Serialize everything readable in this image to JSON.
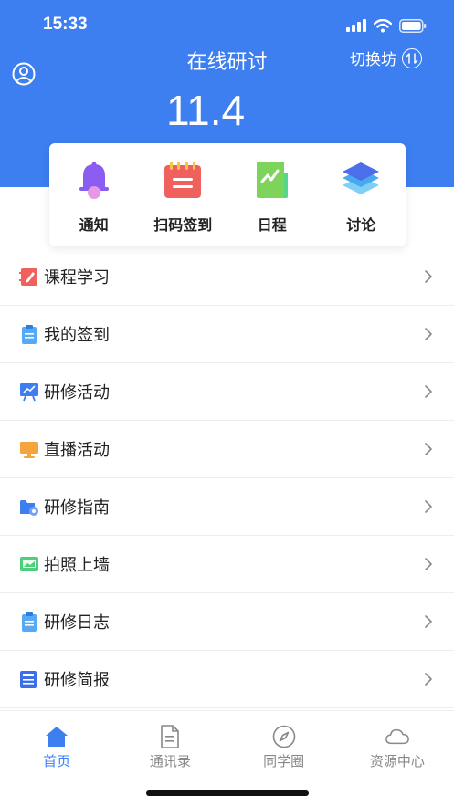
{
  "status": {
    "time": "15:33"
  },
  "header": {
    "title": "在线研讨",
    "switch_label": "切换坊",
    "date": "11.4",
    "colors": {
      "primary": "#3d7ff0"
    }
  },
  "quick_actions": [
    {
      "label": "通知",
      "icon": "bell-icon"
    },
    {
      "label": "扫码签到",
      "icon": "calendar-icon"
    },
    {
      "label": "日程",
      "icon": "chart-card-icon"
    },
    {
      "label": "讨论",
      "icon": "layers-icon"
    }
  ],
  "menu": [
    {
      "label": "课程学习",
      "icon": "notebook-pencil-icon"
    },
    {
      "label": "我的签到",
      "icon": "clipboard-icon"
    },
    {
      "label": "研修活动",
      "icon": "presentation-board-icon"
    },
    {
      "label": "直播活动",
      "icon": "monitor-icon"
    },
    {
      "label": "研修指南",
      "icon": "folder-gear-icon"
    },
    {
      "label": "拍照上墙",
      "icon": "photo-icon"
    },
    {
      "label": "研修日志",
      "icon": "clipboard-icon"
    },
    {
      "label": "研修简报",
      "icon": "newspaper-icon"
    }
  ],
  "tabs": [
    {
      "label": "首页",
      "icon": "home-icon",
      "active": true
    },
    {
      "label": "通讯录",
      "icon": "document-icon",
      "active": false
    },
    {
      "label": "同学圈",
      "icon": "compass-icon",
      "active": false
    },
    {
      "label": "资源中心",
      "icon": "cloud-icon",
      "active": false
    }
  ]
}
